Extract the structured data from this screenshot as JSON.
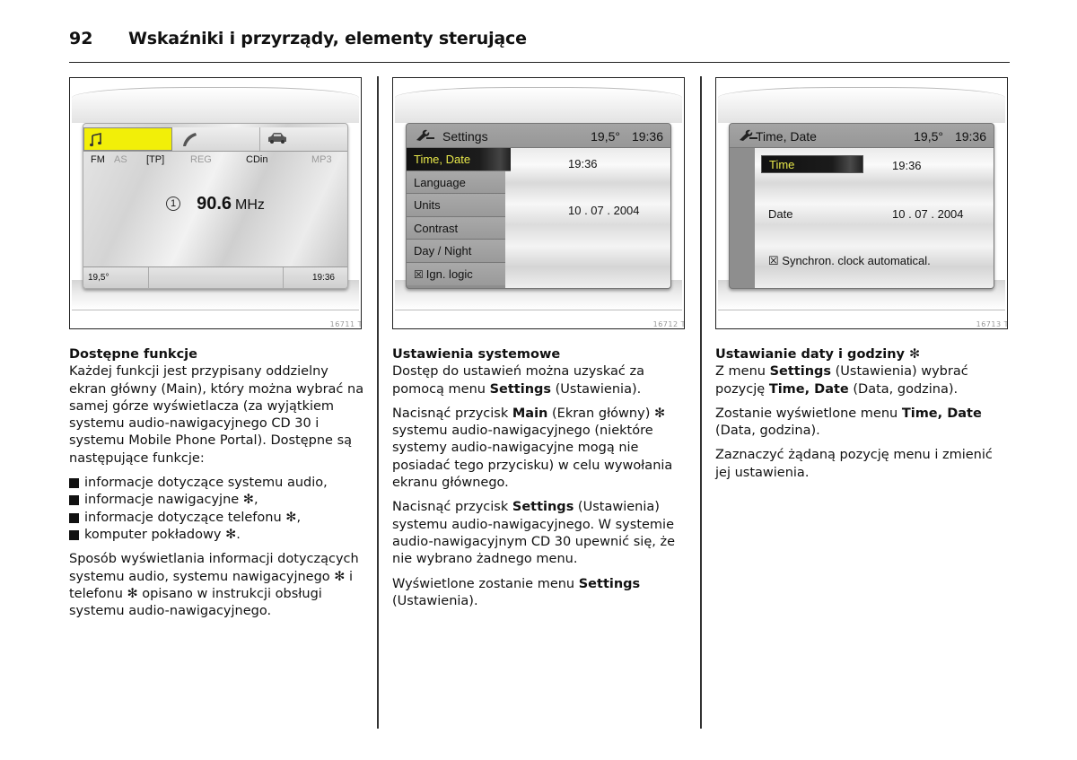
{
  "header": {
    "page_number": "92",
    "title": "Wskaźniki i przyrządy, elementy sterujące"
  },
  "figures": [
    {
      "code": "16711 T",
      "screen": {
        "tabs": [
          {
            "icon": "music-note-icon",
            "active": true
          },
          {
            "icon": "phone-handset-icon",
            "active": false
          },
          {
            "icon": "car-icon",
            "active": false
          }
        ],
        "modes": [
          {
            "label": "FM",
            "active": true
          },
          {
            "label": "AS",
            "active": false
          },
          {
            "label": "[TP]",
            "active": true
          },
          {
            "label": "REG",
            "active": false
          },
          {
            "label": "CDin",
            "active": true
          },
          {
            "label": "MP3",
            "active": false
          }
        ],
        "preset": "1",
        "frequency": "90.6",
        "frequency_unit": "MHz",
        "temperature": "19,5°",
        "time": "19:36",
        "active_tab_color": "#f2ef08"
      }
    },
    {
      "code": "16712 T",
      "screen": {
        "header_icon": "wrench-settings-icon",
        "title": "Settings",
        "temperature": "19,5°",
        "time": "19:36",
        "menu_items": [
          {
            "label": "Time, Date",
            "selected": true
          },
          {
            "label": "Language",
            "selected": false
          },
          {
            "label": "Units",
            "selected": false
          },
          {
            "label": "Contrast",
            "selected": false
          },
          {
            "label": "Day / Night",
            "selected": false
          },
          {
            "label": "Ign. logic",
            "selected": false,
            "checkbox": "☒"
          }
        ],
        "values": {
          "time": "19:36",
          "date": "10 . 07 . 2004"
        },
        "highlight_text_color": "#e8e84a"
      }
    },
    {
      "code": "16713 T",
      "screen": {
        "header_icon": "wrench-settings-icon",
        "title": "Time, Date",
        "temperature": "19,5°",
        "time": "19:36",
        "rows": [
          {
            "label": "Time",
            "value": "19:36",
            "selected": true
          },
          {
            "label": "Date",
            "value": "10 . 07 . 2004",
            "selected": false
          }
        ],
        "sync_checkbox": "☒",
        "sync_label": "Synchron. clock automatical."
      }
    }
  ],
  "columns": [
    {
      "heading": "Dostępne funkcje",
      "intro": "Każdej funkcji jest przypisany oddzielny ekran główny (Main), który można wybrać na samej górze wyświetlacza (za wyjątkiem systemu audio-nawigacyjnego CD 30 i systemu Mobile Phone Portal). Dostępne są następujące funkcje:",
      "bullets": [
        {
          "text": "informacje dotyczące systemu audio,",
          "star": ""
        },
        {
          "text": "informacje nawigacyjne ",
          "star": "✻",
          "after": ","
        },
        {
          "text": "informacje dotyczące telefonu ",
          "star": "✻",
          "after": ","
        },
        {
          "text": "komputer pokładowy ",
          "star": "✻",
          "after": "."
        }
      ],
      "closing_parts": [
        "Sposób wyświetlania informacji dotyczących systemu audio, systemu nawigacyjnego ",
        "✻",
        " i telefonu ",
        "✻",
        " opisano w instrukcji obsługi systemu audio-nawigacyjnego."
      ]
    },
    {
      "heading": "Ustawienia systemowe",
      "p1": [
        "Dostęp do ustawień można uzyskać za pomocą menu ",
        "Settings",
        " (Ustawienia)."
      ],
      "p2": [
        "Nacisnąć przycisk ",
        "Main",
        " (Ekran główny) ",
        "✻",
        " systemu audio-nawigacyjnego (niektóre systemy audio-nawigacyjne mogą nie posiadać tego przycisku) w celu wywołania ekranu głównego."
      ],
      "p3": [
        "Nacisnąć przycisk ",
        "Settings",
        " (Ustawienia) systemu audio-nawigacyjnego. W systemie audio-nawigacyjnym CD 30 upewnić się, że nie wybrano żadnego menu."
      ],
      "p4": [
        "Wyświetlone zostanie menu ",
        "Settings",
        " (Ustawienia)."
      ]
    },
    {
      "heading": "Ustawianie daty i godziny",
      "heading_star": "✻",
      "p1": [
        "Z menu ",
        "Settings",
        " (Ustawienia) wybrać pozycję ",
        "Time, Date",
        " (Data, godzina)."
      ],
      "p2": [
        "Zostanie wyświetlone menu ",
        "Time, Date",
        " (Data, godzina)."
      ],
      "p3": [
        "Zaznaczyć żądaną pozycję menu i zmienić jej ustawienia."
      ]
    }
  ]
}
